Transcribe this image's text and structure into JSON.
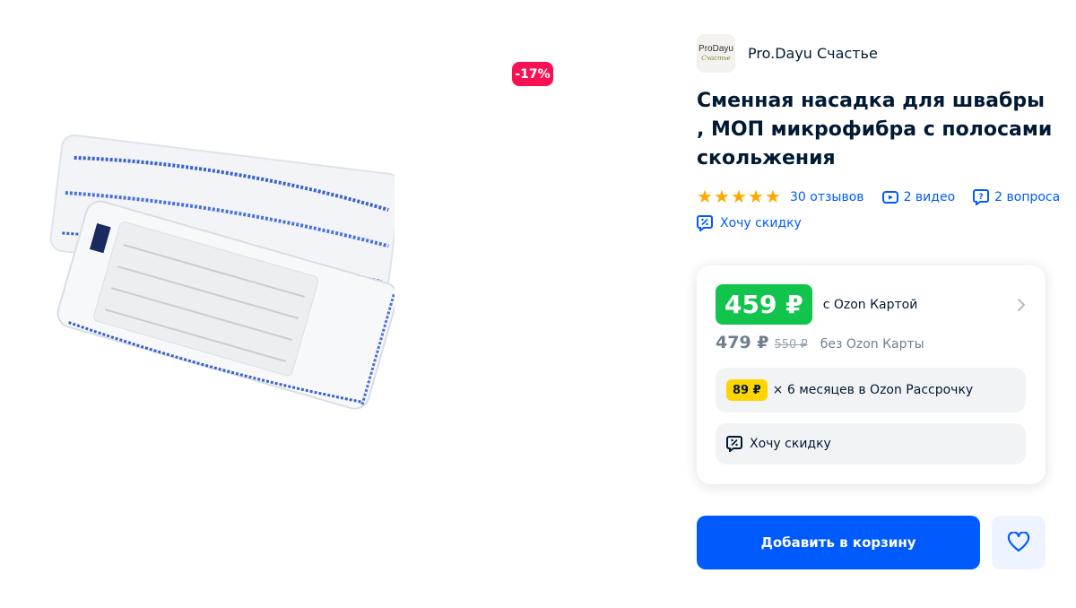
{
  "gallery": {
    "discount_badge": "-17%",
    "image_alt": "Сменная насадка для швабры"
  },
  "seller": {
    "logo_line1": "ProDayu",
    "logo_line2": "Счастье",
    "name": "Pro.Dayu Счастье"
  },
  "product": {
    "title": "Сменная насадка для швабры , МОП микрофибра с полосами скольжения",
    "rating_stars": 5,
    "reviews": "30 отзывов",
    "videos": "2 видео",
    "questions": "2 вопроса",
    "discount_request": "Хочу скидку"
  },
  "price": {
    "card_price": "459 ₽",
    "card_caption": "с Ozon Картой",
    "regular_price": "479 ₽",
    "old_price": "550 ₽",
    "regular_caption": "без Ozon Карты",
    "installment_amount": "89 ₽",
    "installment_text": "× 6 месяцев в Ozon Рассрочку",
    "discount_request": "Хочу скидку"
  },
  "actions": {
    "add_to_cart": "Добавить в корзину"
  },
  "colors": {
    "accent": "#005bff",
    "price_green": "#10c44c",
    "discount_red": "#f91155",
    "installment_yellow": "#ffd500",
    "star": "#ffa800"
  },
  "icons": {
    "stars": "star-icon",
    "video": "video-icon",
    "questions": "question-icon",
    "discount": "percent-tag-icon",
    "chevron": "chevron-right-icon",
    "favorite": "heart-icon"
  }
}
